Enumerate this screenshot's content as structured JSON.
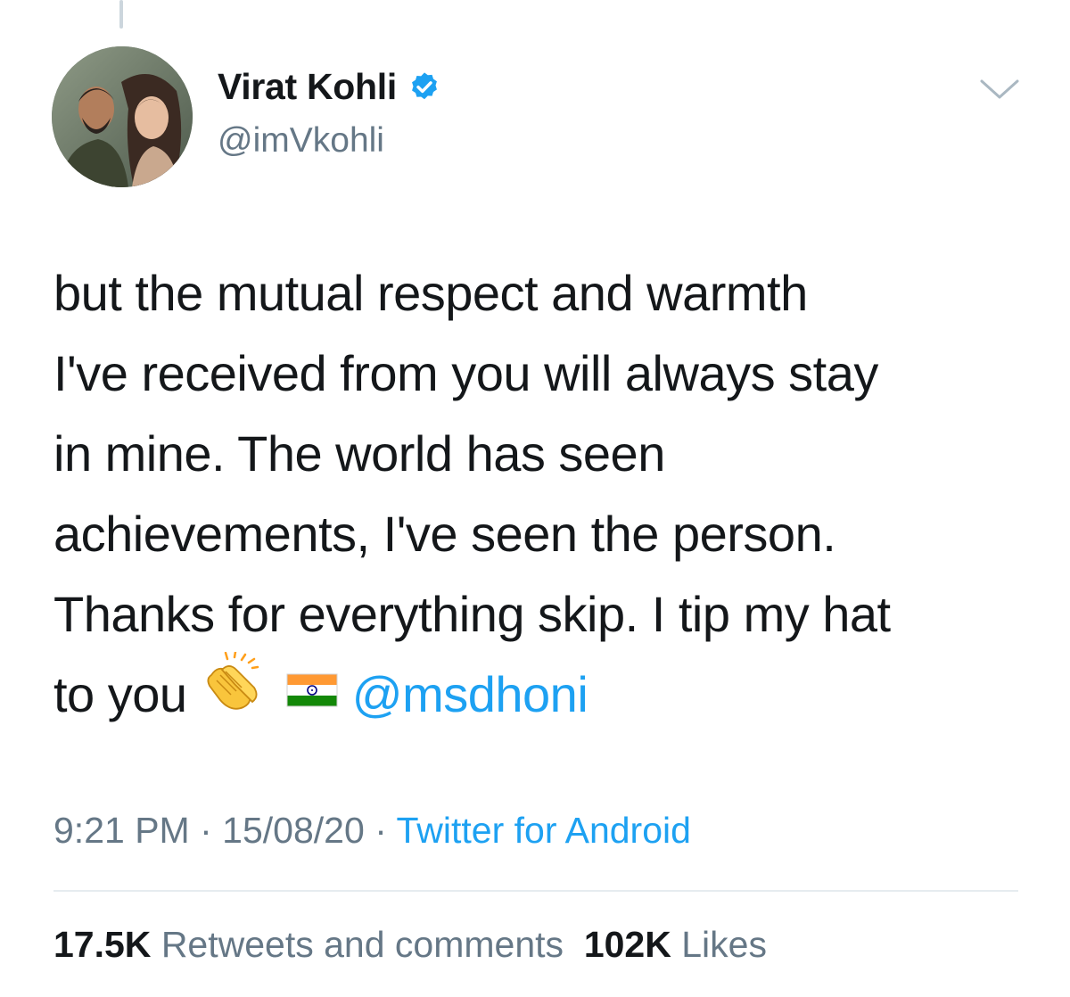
{
  "author": {
    "display_name": "Virat Kohli",
    "handle": "@imVkohli",
    "verified": true
  },
  "icons": {
    "verified": "verified-badge-icon",
    "menu": "chevron-down-icon",
    "clap": "clapping-hands-emoji",
    "flag": "india-flag-emoji"
  },
  "tweet": {
    "lines": [
      "but the mutual respect and warmth",
      "I've received from you will always stay",
      "in mine. The world has seen",
      "achievements, I've seen the person.",
      "Thanks for everything skip. I tip my hat"
    ],
    "last_line_text": "to you",
    "mention": "@msdhoni"
  },
  "meta": {
    "time": "9:21 PM",
    "separator": "·",
    "date": "15/08/20",
    "source": "Twitter for Android"
  },
  "stats": {
    "retweets_count": "17.5K",
    "retweets_label": "Retweets and comments",
    "likes_count": "102K",
    "likes_label": "Likes"
  },
  "colors": {
    "link": "#1da1f2",
    "secondary_text": "#657786",
    "primary_text": "#14171a",
    "divider": "#e6ecf0"
  }
}
